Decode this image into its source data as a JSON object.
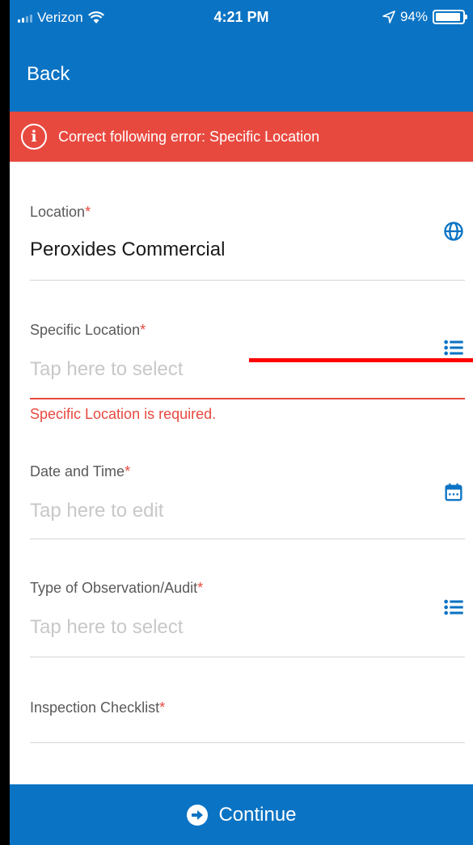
{
  "status_bar": {
    "carrier": "Verizon",
    "time": "4:21 PM",
    "battery": "94%",
    "battery_level": 0.94
  },
  "nav": {
    "back_label": "Back"
  },
  "error_banner": {
    "icon": "info-icon",
    "message": "Correct following error: Specific Location"
  },
  "form": {
    "location": {
      "label": "Location",
      "required_mark": "*",
      "value": "Peroxides Commercial",
      "icon": "globe-icon"
    },
    "specific_location": {
      "label": "Specific Location",
      "required_mark": "*",
      "placeholder": "Tap here to select",
      "error": "Specific Location is required.",
      "icon": "list-icon"
    },
    "date_time": {
      "label": "Date and Time",
      "required_mark": "*",
      "placeholder": "Tap here to edit",
      "icon": "calendar-icon"
    },
    "observation_type": {
      "label": "Type of Observation/Audit",
      "required_mark": "*",
      "placeholder": "Tap here to select",
      "icon": "list-icon"
    },
    "inspection_checklist": {
      "label": "Inspection Checklist",
      "required_mark": "*"
    }
  },
  "footer": {
    "continue_label": "Continue",
    "icon": "arrow-right-circle-icon"
  },
  "colors": {
    "primary": "#0a73c4",
    "error": "#e8493f",
    "annotation": "#ff0000"
  }
}
